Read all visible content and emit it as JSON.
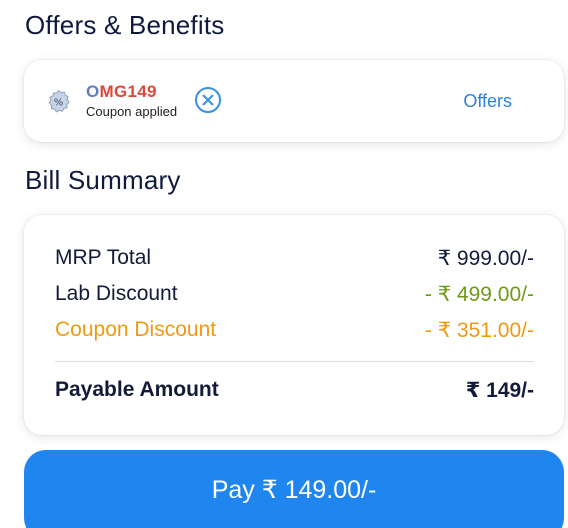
{
  "offers_section": {
    "title": "Offers & Benefits",
    "coupon": {
      "code_first_char": "O",
      "code_rest": "MG149",
      "status": "Coupon applied",
      "icon": "percent-badge-icon",
      "remove_icon": "close-circle-icon"
    },
    "offers_link": "Offers"
  },
  "bill_section": {
    "title": "Bill Summary",
    "rows": [
      {
        "label": "MRP Total",
        "value": "₹ 999.00/-"
      },
      {
        "label": "Lab Discount",
        "value": "- ₹ 499.00/-"
      },
      {
        "label": "Coupon Discount",
        "value": "- ₹ 351.00/-"
      }
    ],
    "payable": {
      "label": "Payable Amount",
      "value": "₹ 149/-"
    }
  },
  "pay_button": {
    "label": "Pay ₹ 149.00/-"
  },
  "colors": {
    "accent_blue": "#1f86f0",
    "link_blue": "#2f7fdc",
    "discount_green": "#6f9a16",
    "coupon_orange": "#ef9a12",
    "coupon_code_red": "#e2463a"
  }
}
